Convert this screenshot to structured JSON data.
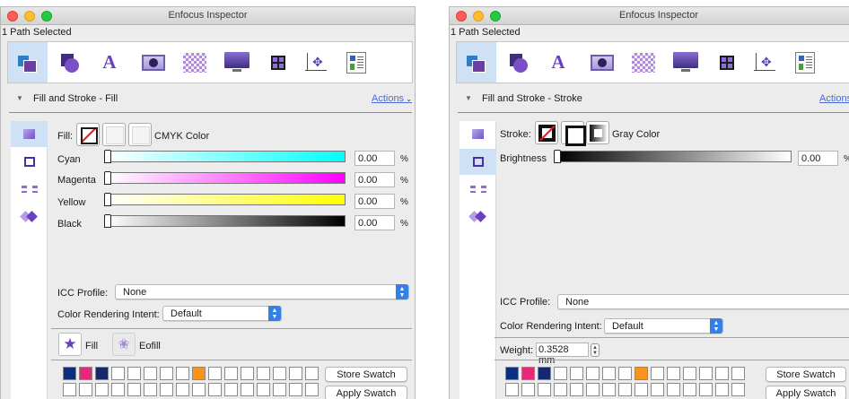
{
  "windows": [
    {
      "title": "Enfocus Inspector",
      "status": "1 Path Selected",
      "section_title": "Fill and Stroke - Fill",
      "actions_label": "Actions",
      "paint_label": "Fill:",
      "color_mode": "CMYK Color",
      "channels": [
        {
          "name": "Cyan",
          "value": "0.00",
          "unit": "%",
          "color": "#00ffff"
        },
        {
          "name": "Magenta",
          "value": "0.00",
          "unit": "%",
          "color": "#ff00ff"
        },
        {
          "name": "Yellow",
          "value": "0.00",
          "unit": "%",
          "color": "#ffff00"
        },
        {
          "name": "Black",
          "value": "0.00",
          "unit": "%",
          "color": "#000000"
        }
      ],
      "icc_label": "ICC Profile:",
      "icc_value": "None",
      "intent_label": "Color Rendering Intent:",
      "intent_value": "Default",
      "rule_fill_label": "Fill",
      "rule_eofill_label": "Eofill",
      "swatches": [
        "#0c2d80",
        "#e6287a",
        "#14286e",
        "",
        "",
        "",
        "",
        "",
        "#f7941d",
        "",
        "",
        "",
        "",
        "",
        "",
        "",
        "",
        ""
      ],
      "store_label": "Store Swatch",
      "apply_label": "Apply Swatch"
    },
    {
      "title": "Enfocus Inspector",
      "status": "1 Path Selected",
      "section_title": "Fill and Stroke - Stroke",
      "actions_label": "Actions",
      "paint_label": "Stroke:",
      "color_mode": "Gray Color",
      "channels": [
        {
          "name": "Brightness",
          "value": "0.00",
          "unit": "%",
          "color": "#000000"
        }
      ],
      "icc_label": "ICC Profile:",
      "icc_value": "None",
      "intent_label": "Color Rendering Intent:",
      "intent_value": "Default",
      "weight_label": "Weight:",
      "weight_value": "0.3528 mm",
      "swatches": [
        "#0c2d80",
        "#e6287a",
        "#14286e",
        "",
        "",
        "",
        "",
        "",
        "#f7941d",
        "",
        "",
        "",
        "",
        "",
        "",
        "",
        "",
        ""
      ],
      "store_label": "Store Swatch",
      "apply_label": "Apply Swatch"
    }
  ],
  "toolbar_icons": [
    "object-icon",
    "shape-icon",
    "text-icon",
    "image-icon",
    "transparency-icon",
    "screen-icon",
    "layout-icon",
    "move-icon",
    "preferences-icon"
  ],
  "sidebar_icons": [
    "fill-icon",
    "stroke-icon",
    "dash-icon",
    "overprint-icon"
  ]
}
